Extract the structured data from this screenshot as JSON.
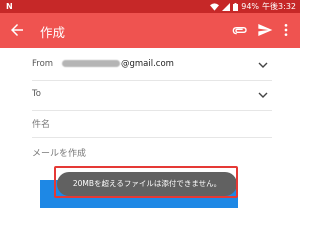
{
  "status_bar": {
    "left_glyph": "N",
    "battery": "94%",
    "time": "午後3:32"
  },
  "app_bar": {
    "title": "作成",
    "icons": [
      "back-arrow-icon",
      "attach-icon",
      "send-icon",
      "more-vert-icon"
    ]
  },
  "compose": {
    "from_label": "From",
    "from_value": "@gmail.com",
    "to_label": "To",
    "subject_placeholder": "件名",
    "body_placeholder": "メールを作成"
  },
  "toast": {
    "message": "20MBを超えるファイルは添付できません。"
  },
  "colors": {
    "status_bar": "#c62828",
    "app_bar": "#ef5350",
    "toast_bg": "#616161",
    "highlight": "#e53935",
    "attachment_preview": "#1e88e5"
  }
}
